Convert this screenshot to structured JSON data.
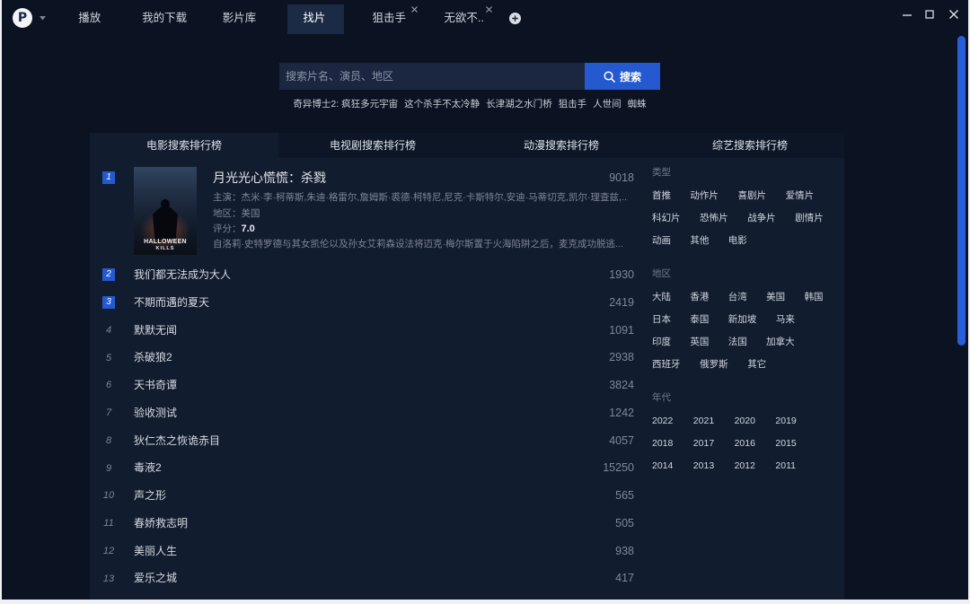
{
  "theme": {
    "background": "#0b1221",
    "panel": "#111c2e",
    "tabs": "#0d1627",
    "accent": "#2459d0"
  },
  "app": {
    "logo_letter": "P",
    "logo_icon": "app-logo-icon",
    "menu_icon": "chevron-down-icon"
  },
  "top_tabs": [
    {
      "label": "播放"
    },
    {
      "label": "我的下载"
    },
    {
      "label": "影片库"
    },
    {
      "label": "找片",
      "active": true
    },
    {
      "label": "狙击手",
      "closable": true
    },
    {
      "label": "无欲不..",
      "closable": true
    }
  ],
  "new_tab_icon": "plus-circle-icon",
  "window_controls": [
    "minimize-icon",
    "maximize-icon",
    "close-icon"
  ],
  "search": {
    "placeholder": "搜索片名、演员、地区",
    "button_label": "搜索",
    "button_icon": "search-icon"
  },
  "hot_searches": [
    "奇异博士2: 疯狂多元宇宙",
    "这个杀手不太冷静",
    "长津湖之水门桥",
    "狙击手",
    "人世间",
    "蜘蛛"
  ],
  "rank_tabs": [
    {
      "label": "电影搜索排行榜",
      "active": true
    },
    {
      "label": "电视剧搜索排行榜"
    },
    {
      "label": "动漫搜索排行榜"
    },
    {
      "label": "综艺搜索排行榜"
    }
  ],
  "ranking": [
    {
      "rank": 1,
      "title": "月光光心慌慌：杀戮",
      "count": 9018,
      "cast": "主演：杰米·李·柯蒂斯,朱迪·格雷尔,詹姆斯·裘德·柯特尼,尼克·卡斯特尔,安迪·马蒂切克,凯尔·理查兹,...",
      "region": "地区：美国",
      "rating_label": "评分：",
      "rating": "7.0",
      "synopsis": "自洛莉·史特罗德与其女凯伦以及孙女艾莉森设法将迈克·梅尔斯置于火海陷阱之后，麦克成功脱逃...",
      "poster_text": [
        "HALLOWEEN",
        "KILLS"
      ]
    },
    {
      "rank": 2,
      "title": "我们都无法成为大人",
      "count": 1930
    },
    {
      "rank": 3,
      "title": "不期而遇的夏天",
      "count": 2419
    },
    {
      "rank": 4,
      "title": "默默无闻",
      "count": 1091
    },
    {
      "rank": 5,
      "title": "杀破狼2",
      "count": 2938
    },
    {
      "rank": 6,
      "title": "天书奇谭",
      "count": 3824
    },
    {
      "rank": 7,
      "title": "验收测试",
      "count": 1242
    },
    {
      "rank": 8,
      "title": "狄仁杰之恢诡赤目",
      "count": 4057
    },
    {
      "rank": 9,
      "title": "毒液2",
      "count": 15250
    },
    {
      "rank": 10,
      "title": "声之形",
      "count": 565
    },
    {
      "rank": 11,
      "title": "春娇救志明",
      "count": 505
    },
    {
      "rank": 12,
      "title": "美丽人生",
      "count": 938
    },
    {
      "rank": 13,
      "title": "爱乐之城",
      "count": 417
    }
  ],
  "filters": [
    {
      "label": "类型",
      "items": [
        "首推",
        "动作片",
        "喜剧片",
        "爱情片",
        "科幻片",
        "恐怖片",
        "战争片",
        "剧情片",
        "动画",
        "其他",
        "电影"
      ]
    },
    {
      "label": "地区",
      "items": [
        "大陆",
        "香港",
        "台湾",
        "美国",
        "韩国",
        "日本",
        "泰国",
        "新加坡",
        "马来",
        "印度",
        "英国",
        "法国",
        "加拿大",
        "西班牙",
        "俄罗斯",
        "其它"
      ]
    },
    {
      "label": "年代",
      "items": [
        "2022",
        "2021",
        "2020",
        "2019",
        "2018",
        "2017",
        "2016",
        "2015",
        "2014",
        "2013",
        "2012",
        "2011"
      ]
    }
  ],
  "scroll": {
    "visible_percent": 55,
    "scrolled_percent": 0
  }
}
